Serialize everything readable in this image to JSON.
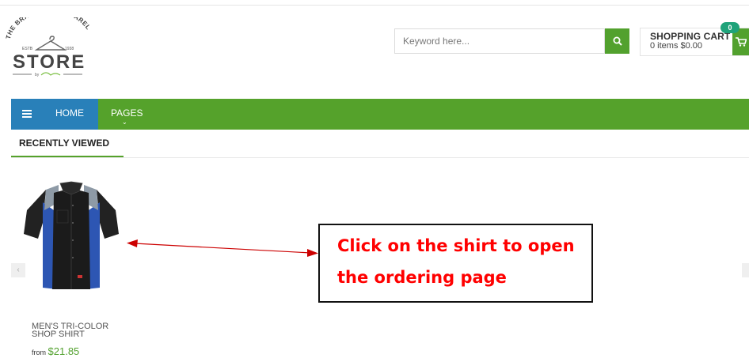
{
  "logo": {
    "top_text": "THE BRANDING & APPAREL",
    "estb": "ESTB",
    "year": "1938",
    "store": "STORE",
    "sub": "by"
  },
  "search": {
    "placeholder": "Keyword here...",
    "icon": "search-icon"
  },
  "cart": {
    "title": "SHOPPING CART",
    "summary": "0 items $0.00",
    "count": "0",
    "icon": "cart-icon"
  },
  "nav": {
    "menu_icon": "hamburger-icon",
    "home_label": "HOME",
    "pages_label": "PAGES",
    "pages_caret": "⌄"
  },
  "recently_viewed": {
    "tab_label": "RECENTLY VIEWED",
    "prev_label": "‹"
  },
  "product": {
    "name_line1": "MEN'S TRI-COLOR",
    "name_line2": "SHOP SHIRT",
    "price_prefix": "from",
    "price": "$21.85"
  },
  "annotation": {
    "line1": "Click on the shirt to open",
    "line2": "the ordering page",
    "color": "#ff0000"
  },
  "colors": {
    "brand_green": "#55a22b",
    "nav_blue": "#2980b9",
    "badge": "#1fa37a"
  }
}
